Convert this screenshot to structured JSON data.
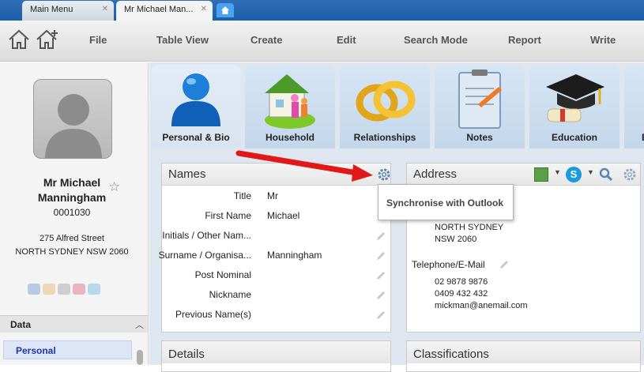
{
  "tabs": [
    {
      "label": "Main Menu"
    },
    {
      "label": "Mr Michael Man..."
    }
  ],
  "toolbar": {
    "menu": [
      "File",
      "Table View",
      "Create",
      "Edit",
      "Search Mode",
      "Report",
      "Write"
    ]
  },
  "contact": {
    "name_line1": "Mr Michael",
    "name_line2": "Manningham",
    "id": "0001030",
    "address_line1": "275 Alfred Street",
    "address_line2": "NORTH SYDNEY NSW 2060"
  },
  "sidebar": {
    "section": "Data",
    "nav_selected": "Personal"
  },
  "icon_tabs": [
    {
      "label": "Personal & Bio"
    },
    {
      "label": "Household"
    },
    {
      "label": "Relationships"
    },
    {
      "label": "Notes"
    },
    {
      "label": "Education"
    }
  ],
  "names_panel": {
    "title": "Names",
    "rows": [
      {
        "label": "Title",
        "value": "Mr"
      },
      {
        "label": "First Name",
        "value": "Michael"
      },
      {
        "label": "Initials / Other Nam...",
        "value": ""
      },
      {
        "label": "Surname / Organisa...",
        "value": "Manningham"
      },
      {
        "label": "Post Nominal",
        "value": ""
      },
      {
        "label": "Nickname",
        "value": ""
      },
      {
        "label": "Previous Name(s)",
        "value": ""
      }
    ]
  },
  "address_panel": {
    "title": "Address",
    "address_line1": "NORTH SYDNEY",
    "address_line2": "NSW 2060",
    "phone_heading": "Telephone/E-Mail",
    "phone1": "02 9878 9876",
    "phone2": "0409 432 432",
    "email": "mickman@anemail.com"
  },
  "tooltip": {
    "text": "Synchronise with Outlook"
  },
  "details_panel": {
    "title": "Details"
  },
  "classifications_panel": {
    "title": "Classifications"
  },
  "colors": {
    "tabbar": "#1d5ea8",
    "arrow": "#e01818",
    "accent_blue": "#2134a8"
  }
}
